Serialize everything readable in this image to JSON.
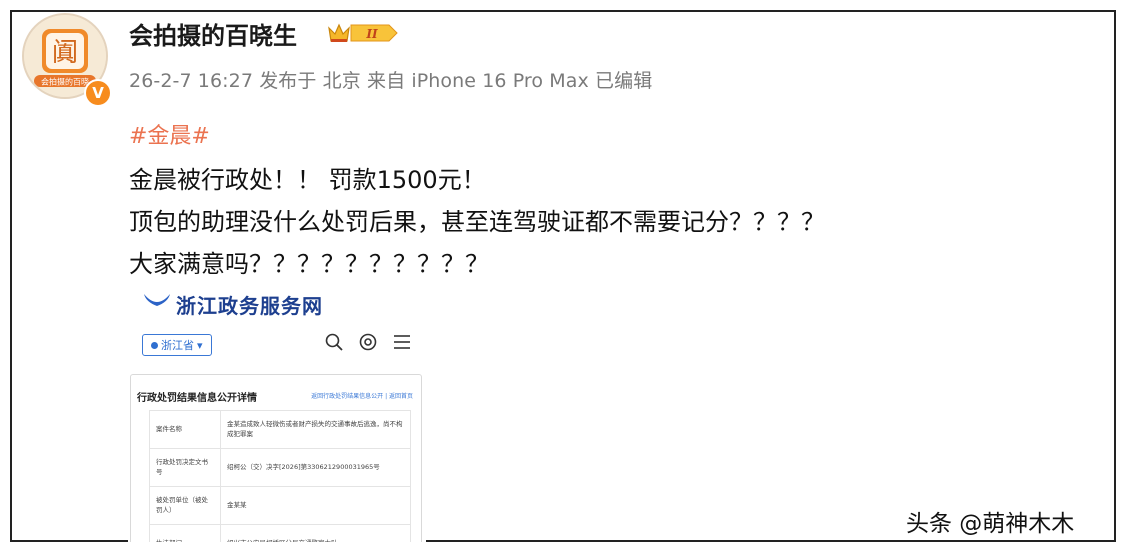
{
  "post": {
    "username": "会拍摄的百晓生",
    "avatar_text": "会拍摄的百晓",
    "avatar_glyph": "阗",
    "vip_level": "II",
    "meta": "26-2-7 16:27 发布于 北京 来自 iPhone 16 Pro Max 已编辑",
    "topic": "#金晨#",
    "lines": [
      "金晨被行政处！！ 罚款1500元！",
      "顶包的助理没什么处罚后果，甚至连驾驶证都不需要记分？？？？",
      "大家满意吗？？？？？？？？？？"
    ],
    "verified_badge": "V"
  },
  "image": {
    "site_title": "浙江政务服务网",
    "region": "浙江省",
    "card_title": "行政处罚结果信息公开详情",
    "card_links": "返回行政处罚结果信息公开 | 返回首页",
    "rows": [
      {
        "k": "案件名称",
        "v": "金某造成致人轻微伤或者财产损失的交通事故后逃逸，尚不构成犯罪案"
      },
      {
        "k": "行政处罚决定文书号",
        "v": "绍柯公（交）决字[2026]第3306212900031965号"
      },
      {
        "k": "被处罚单位（被处罚人）",
        "v": "金某某"
      },
      {
        "k": "执法部门",
        "v": "绍兴市公安局柯桥区分局交通警察大队"
      }
    ]
  },
  "watermark": "头条 @萌神木木",
  "colors": {
    "topic": "#eb7350",
    "meta": "#7a7a7a",
    "badge": "#f78c1e",
    "gov_blue": "#1d3f8f"
  }
}
